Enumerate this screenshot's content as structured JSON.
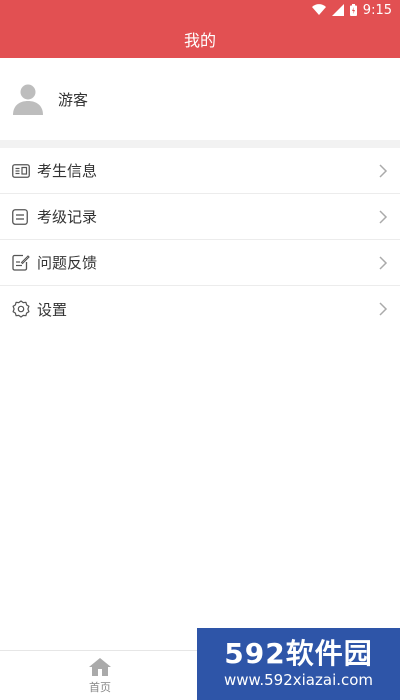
{
  "status_bar": {
    "time": "9:15"
  },
  "header": {
    "title": "我的"
  },
  "profile": {
    "name": "游客"
  },
  "menu": {
    "items": [
      {
        "label": "考生信息"
      },
      {
        "label": "考级记录"
      },
      {
        "label": "问题反馈"
      },
      {
        "label": "设置"
      }
    ]
  },
  "bottom_nav": {
    "items": [
      {
        "label": "首页"
      }
    ]
  },
  "watermark": {
    "brand": "592软件园",
    "url": "www.592xiazai.com"
  },
  "colors": {
    "accent": "#e25052",
    "watermark_bg": "#2e55a8"
  }
}
